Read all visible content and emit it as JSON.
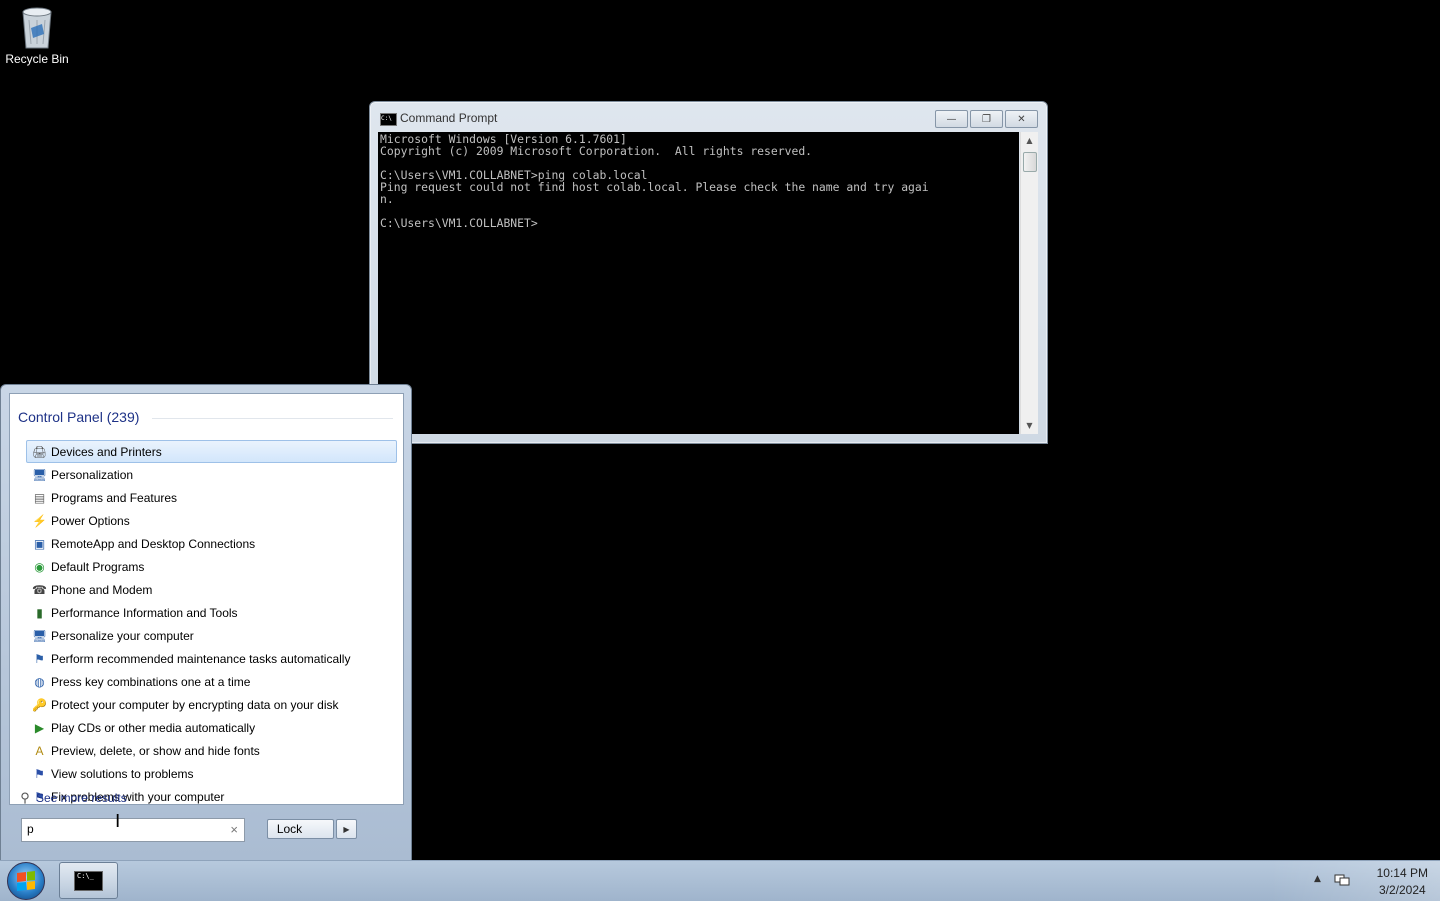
{
  "desktop": {
    "recycle_bin_label": "Recycle Bin"
  },
  "cmd_window": {
    "title": "Command Prompt",
    "console_lines": [
      "Microsoft Windows [Version 6.1.7601]",
      "Copyright (c) 2009 Microsoft Corporation.  All rights reserved.",
      "",
      "C:\\Users\\VM1.COLLABNET>ping colab.local",
      "Ping request could not find host colab.local. Please check the name and try agai",
      "n.",
      "",
      "C:\\Users\\VM1.COLLABNET>"
    ],
    "buttons": {
      "minimize": "minimize-icon",
      "restore": "restore-icon",
      "close": "close-icon"
    }
  },
  "start_menu": {
    "section_header": "Control Panel (239)",
    "results": [
      {
        "label": "Devices and Printers",
        "icon": "printer-icon",
        "selected": true
      },
      {
        "label": "Personalization",
        "icon": "monitor-icon"
      },
      {
        "label": "Programs and Features",
        "icon": "programs-icon"
      },
      {
        "label": "Power Options",
        "icon": "power-icon"
      },
      {
        "label": "RemoteApp and Desktop Connections",
        "icon": "remoteapp-icon"
      },
      {
        "label": "Default Programs",
        "icon": "default-programs-icon"
      },
      {
        "label": "Phone and Modem",
        "icon": "phone-icon"
      },
      {
        "label": "Performance Information and Tools",
        "icon": "performance-icon"
      },
      {
        "label": "Personalize your computer",
        "icon": "monitor-icon"
      },
      {
        "label": "Perform recommended maintenance tasks automatically",
        "icon": "maintenance-icon"
      },
      {
        "label": "Press key combinations one at a time",
        "icon": "ease-of-access-icon"
      },
      {
        "label": "Protect your computer by encrypting data on your disk",
        "icon": "bitlocker-icon"
      },
      {
        "label": "Play CDs or other media automatically",
        "icon": "autoplay-icon"
      },
      {
        "label": "Preview, delete, or show and hide fonts",
        "icon": "fonts-icon"
      },
      {
        "label": "View solutions to problems",
        "icon": "flag-icon"
      },
      {
        "label": "Fix problems with your computer",
        "icon": "flag-icon"
      }
    ],
    "see_more": "See more results",
    "search_value": "p",
    "lock_label": "Lock"
  },
  "taskbar": {
    "time": "10:14 PM",
    "date": "3/2/2024"
  }
}
